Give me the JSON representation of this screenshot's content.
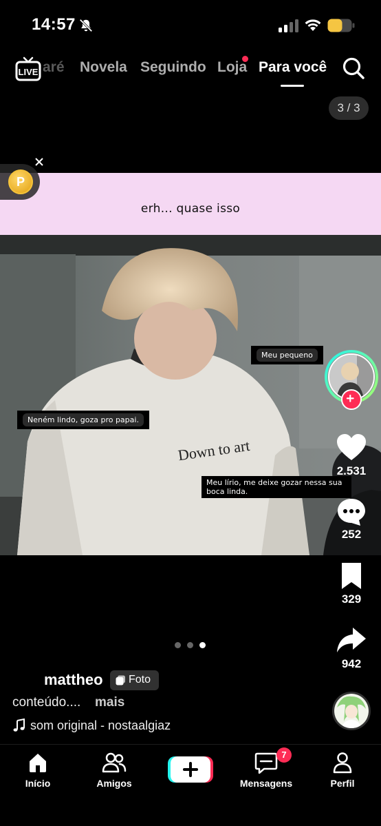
{
  "status_bar": {
    "time": "14:57",
    "icons": [
      "bell-muted-icon",
      "signal-icon",
      "wifi-icon",
      "battery-icon"
    ],
    "battery_color": "#f5c542"
  },
  "top_nav": {
    "tabs": [
      {
        "label": "aré",
        "state": "faded"
      },
      {
        "label": "Novela",
        "state": "inactive"
      },
      {
        "label": "Seguindo",
        "state": "inactive"
      },
      {
        "label": "Loja",
        "state": "inactive",
        "badge_dot": true
      },
      {
        "label": "Para você",
        "state": "active"
      }
    ],
    "live_icon_text": "LIVE"
  },
  "post": {
    "slide_counter": "3 / 3",
    "coin_icon_letter": "P",
    "caption_banner": "erh... quase isso",
    "stickers": [
      "Meu pequeno",
      "Neném lindo, goza pro papai.",
      "Meu lírio, me deixe gozar nessa sua boca linda."
    ],
    "shirt_print": "Down to art",
    "carousel": {
      "count": 3,
      "active_index": 2
    },
    "username": "mattheo",
    "type_badge": "Foto",
    "description": "conteúdo....",
    "more_label": "mais",
    "sound": "som original - nostaalgiaz"
  },
  "actions": {
    "likes": "2.531",
    "comments": "252",
    "saves": "329",
    "shares": "942"
  },
  "bottom_nav": {
    "items": [
      {
        "label": "Início"
      },
      {
        "label": "Amigos"
      },
      {
        "label": "Mensagens",
        "badge": "7"
      },
      {
        "label": "Perfil"
      }
    ]
  },
  "colors": {
    "accent": "#fe2c55",
    "accent_cyan": "#25f4ee",
    "caption_band": "#f5d8f3"
  }
}
